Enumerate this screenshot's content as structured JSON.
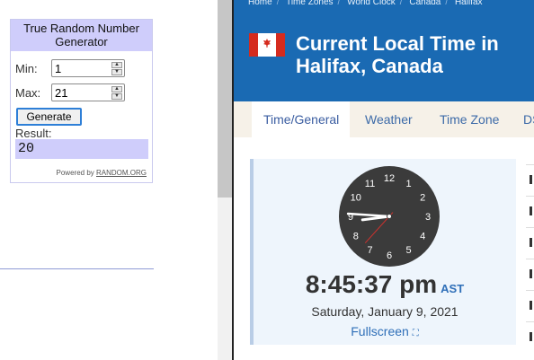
{
  "widget": {
    "title": "True Random Number Generator",
    "min_label": "Min:",
    "min_value": "1",
    "max_label": "Max:",
    "max_value": "21",
    "generate_label": "Generate",
    "result_label": "Result:",
    "result_value": "20",
    "powered_prefix": "Powered by",
    "powered_link": "RANDOM.ORG"
  },
  "panel": {
    "breadcrumb": [
      "Home",
      "Time Zones",
      "World Clock",
      "Canada",
      "Halifax"
    ],
    "title": "Current Local Time in Halifax, Canada",
    "tabs": [
      "Time/General",
      "Weather",
      "Time Zone",
      "DST"
    ],
    "active_tab": "Time/General",
    "clock": {
      "numbers": [
        "12",
        "1",
        "2",
        "3",
        "4",
        "5",
        "6",
        "7",
        "8",
        "9",
        "10",
        "11"
      ],
      "hour": 8,
      "minute": 45,
      "second": 37
    },
    "time": "8:45:37 pm",
    "timezone": "AST",
    "date": "Saturday, January 9, 2021",
    "fullscreen_label": "Fullscreen",
    "colors": {
      "topbar": "#1a6ab3",
      "accent": "#2f6fb8",
      "second_hand": "#d0312d"
    }
  }
}
